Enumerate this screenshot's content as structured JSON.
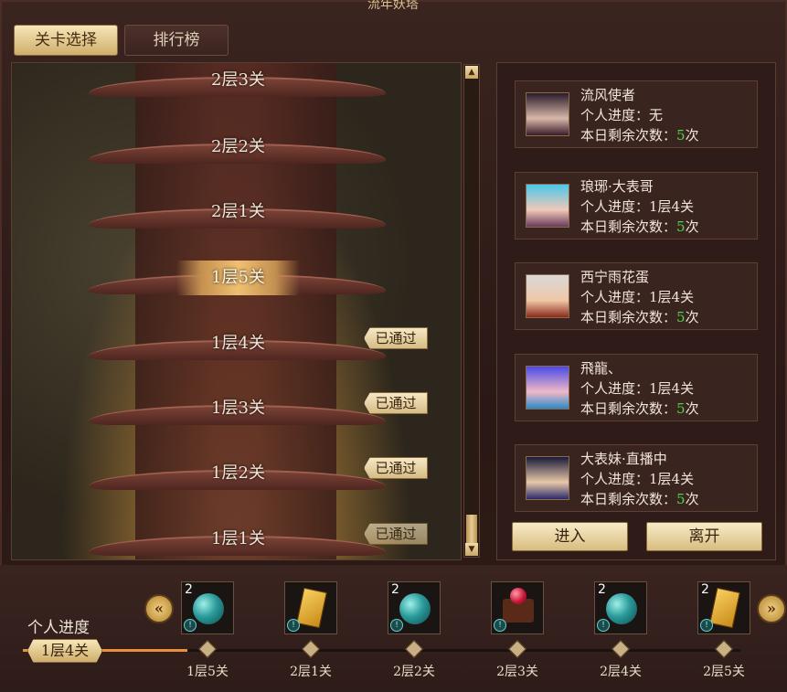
{
  "header": {
    "title": "流年妖塔"
  },
  "tabs": [
    {
      "label": "关卡选择",
      "active": true
    },
    {
      "label": "排行榜",
      "active": false
    }
  ],
  "tower": {
    "floors": [
      {
        "label": "2层3关",
        "passed": false,
        "selected": false
      },
      {
        "label": "2层2关",
        "passed": false,
        "selected": false
      },
      {
        "label": "2层1关",
        "passed": false,
        "selected": false
      },
      {
        "label": "1层5关",
        "passed": false,
        "selected": true
      },
      {
        "label": "1层4关",
        "passed": true,
        "selected": false
      },
      {
        "label": "1层3关",
        "passed": true,
        "selected": false
      },
      {
        "label": "1层2关",
        "passed": true,
        "selected": false
      },
      {
        "label": "1层1关",
        "passed": true,
        "selected": false
      }
    ],
    "passed_label": "已通过"
  },
  "players": [
    {
      "name": "流风使者",
      "progress_label": "个人进度：",
      "progress": "无",
      "remaining_label": "本日剩余次数：",
      "remaining": "5",
      "remaining_unit": "次"
    },
    {
      "name": "琅琊·大表哥",
      "progress_label": "个人进度：",
      "progress": "1层4关",
      "remaining_label": "本日剩余次数：",
      "remaining": "5",
      "remaining_unit": "次"
    },
    {
      "name": "西宁雨花蛋",
      "progress_label": "个人进度：",
      "progress": "1层4关",
      "remaining_label": "本日剩余次数：",
      "remaining": "5",
      "remaining_unit": "次"
    },
    {
      "name": "飛龍、",
      "progress_label": "个人进度：",
      "progress": "1层4关",
      "remaining_label": "本日剩余次数：",
      "remaining": "5",
      "remaining_unit": "次"
    },
    {
      "name": "大表妹·直播中",
      "progress_label": "个人进度：",
      "progress": "1层4关",
      "remaining_label": "本日剩余次数：",
      "remaining": "5",
      "remaining_unit": "次"
    }
  ],
  "actions": {
    "enter": "进入",
    "leave": "离开"
  },
  "rewards": [
    {
      "qty": "2",
      "icon": "teal-gem-icon"
    },
    {
      "qty": "",
      "icon": "gold-book-icon"
    },
    {
      "qty": "2",
      "icon": "teal-gem-icon"
    },
    {
      "qty": "",
      "icon": "red-orb-icon"
    },
    {
      "qty": "2",
      "icon": "teal-gem-icon"
    },
    {
      "qty": "2",
      "icon": "gold-book-icon"
    }
  ],
  "progress": {
    "title": "个人进度",
    "current": "1层4关",
    "milestones": [
      "1层5关",
      "2层1关",
      "2层2关",
      "2层3关",
      "2层4关",
      "2层5关"
    ]
  },
  "colors": {
    "accent_gold": "#d8bc80",
    "remaining_green": "#4ed04a",
    "progress_orange": "#e89040"
  }
}
